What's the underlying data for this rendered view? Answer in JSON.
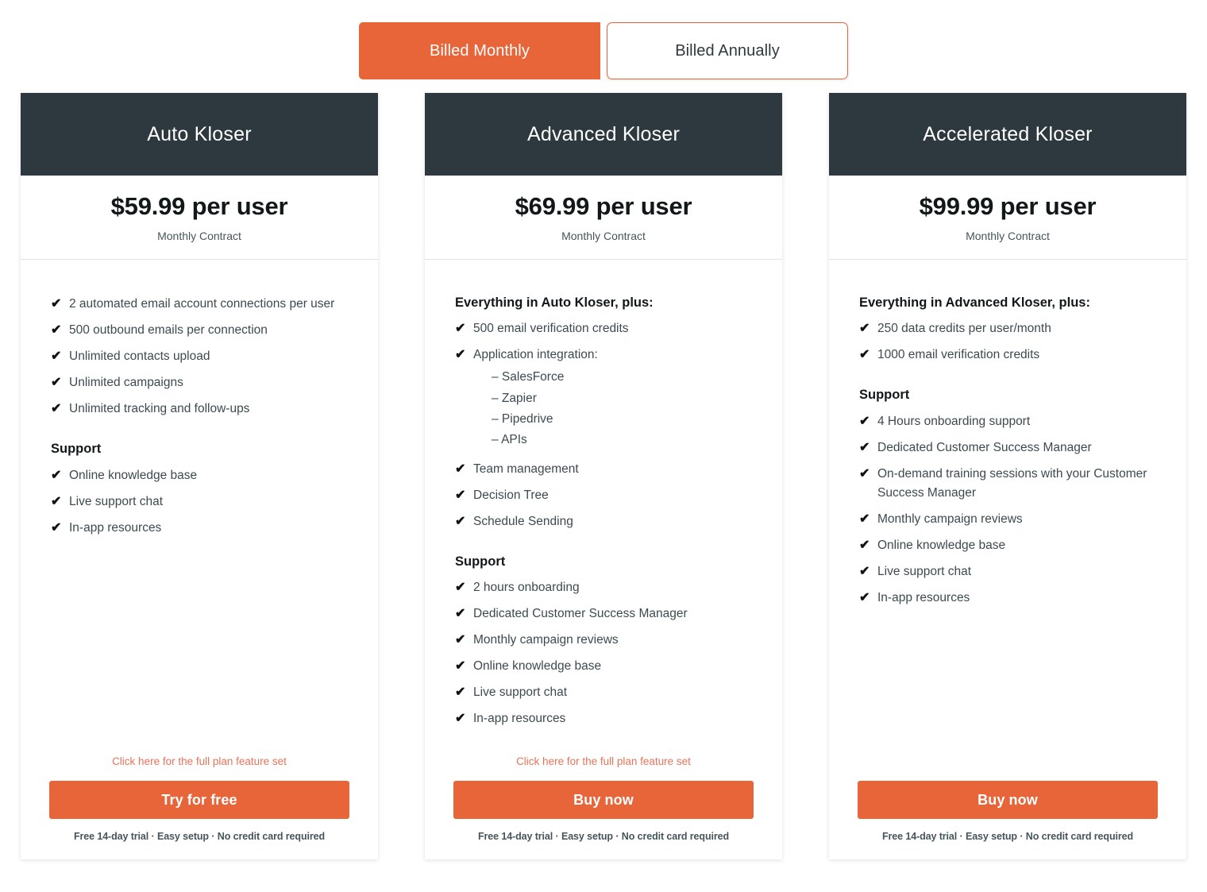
{
  "colors": {
    "accent": "#e8653a",
    "accent_light": "#e8735a",
    "header_dark": "#2d393e",
    "body_text": "#3c4a50"
  },
  "billing_toggle": {
    "options": [
      {
        "label": "Billed Monthly",
        "state": "active"
      },
      {
        "label": "Billed Annually",
        "state": "inactive"
      }
    ]
  },
  "plans": [
    {
      "name": "Auto Kloser",
      "price": "$59.99 per user",
      "term": "Monthly Contract",
      "intro_heading": "",
      "features": [
        {
          "text": "2 automated email account connections per user"
        },
        {
          "text": "500 outbound emails per connection"
        },
        {
          "text": "Unlimited contacts upload"
        },
        {
          "text": "Unlimited campaigns"
        },
        {
          "text": "Unlimited tracking and follow-ups"
        }
      ],
      "support_heading": "Support",
      "support": [
        {
          "text": "Online knowledge base"
        },
        {
          "text": "Live support chat"
        },
        {
          "text": "In-app resources"
        }
      ],
      "full_feature_link": "Click here for the full plan feature set",
      "cta_label": "Try for free",
      "cta_note": "Free 14-day trial · Easy setup · No credit card required"
    },
    {
      "name": "Advanced Kloser",
      "price": "$69.99 per user",
      "term": "Monthly Contract",
      "intro_heading": "Everything in Auto Kloser, plus:",
      "features": [
        {
          "text": "500 email verification credits"
        },
        {
          "text": "Application integration:",
          "sub": [
            "– SalesForce",
            "– Zapier",
            "– Pipedrive",
            "– APIs"
          ]
        },
        {
          "text": "Team management"
        },
        {
          "text": "Decision Tree"
        },
        {
          "text": "Schedule Sending"
        }
      ],
      "support_heading": "Support",
      "support": [
        {
          "text": "2 hours onboarding"
        },
        {
          "text": "Dedicated Customer Success Manager"
        },
        {
          "text": "Monthly campaign reviews"
        },
        {
          "text": "Online knowledge base"
        },
        {
          "text": "Live support chat"
        },
        {
          "text": "In-app resources"
        }
      ],
      "full_feature_link": "Click here for the full plan feature set",
      "cta_label": "Buy now",
      "cta_note": "Free 14-day trial · Easy setup · No credit card required"
    },
    {
      "name": "Accelerated Kloser",
      "price": "$99.99 per user",
      "term": "Monthly Contract",
      "intro_heading": "Everything in Advanced Kloser, plus:",
      "features": [
        {
          "text": "250 data credits per user/month"
        },
        {
          "text": "1000 email verification credits"
        }
      ],
      "support_heading": "Support",
      "support": [
        {
          "text": "4 Hours onboarding support"
        },
        {
          "text": "Dedicated Customer Success Manager"
        },
        {
          "text": "On-demand training sessions with your Customer Success Manager"
        },
        {
          "text": "Monthly campaign reviews"
        },
        {
          "text": "Online knowledge base"
        },
        {
          "text": "Live support chat"
        },
        {
          "text": "In-app resources"
        }
      ],
      "full_feature_link": "",
      "cta_label": "Buy now",
      "cta_note": "Free 14-day trial · Easy setup · No credit card required"
    }
  ],
  "icons": {
    "check": "✔"
  }
}
